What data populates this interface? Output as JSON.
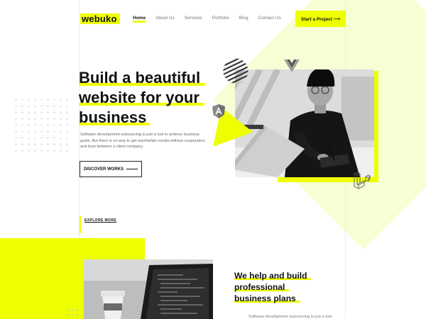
{
  "brand": {
    "logo_text": "webuko",
    "accent_color": "#eeff00"
  },
  "nav": {
    "items": [
      {
        "label": "Home",
        "active": true
      },
      {
        "label": "About Us",
        "active": false
      },
      {
        "label": "Services",
        "active": false
      },
      {
        "label": "Portfolio",
        "active": false
      },
      {
        "label": "Blog",
        "active": false
      },
      {
        "label": "Contact Us",
        "active": false
      }
    ],
    "cta_label": "Start a Project ⟶"
  },
  "hero": {
    "title_lines": [
      "Build a beautiful",
      "website for your",
      "business"
    ],
    "description": "Software development outsourcing is just a tool to achieve business goals. But there is no way to get worthwhile results without cooperation and trust between a client company.",
    "discover_label": "DISCOVER WORKS",
    "explore_label": "EXPLORE MORE",
    "badges": [
      "angular-icon",
      "vue-icon",
      "laravel-icon"
    ]
  },
  "section2": {
    "title_lines": [
      "We help and build",
      "professional",
      "business plans"
    ],
    "description": "Software development outsourcing is just a tool"
  }
}
